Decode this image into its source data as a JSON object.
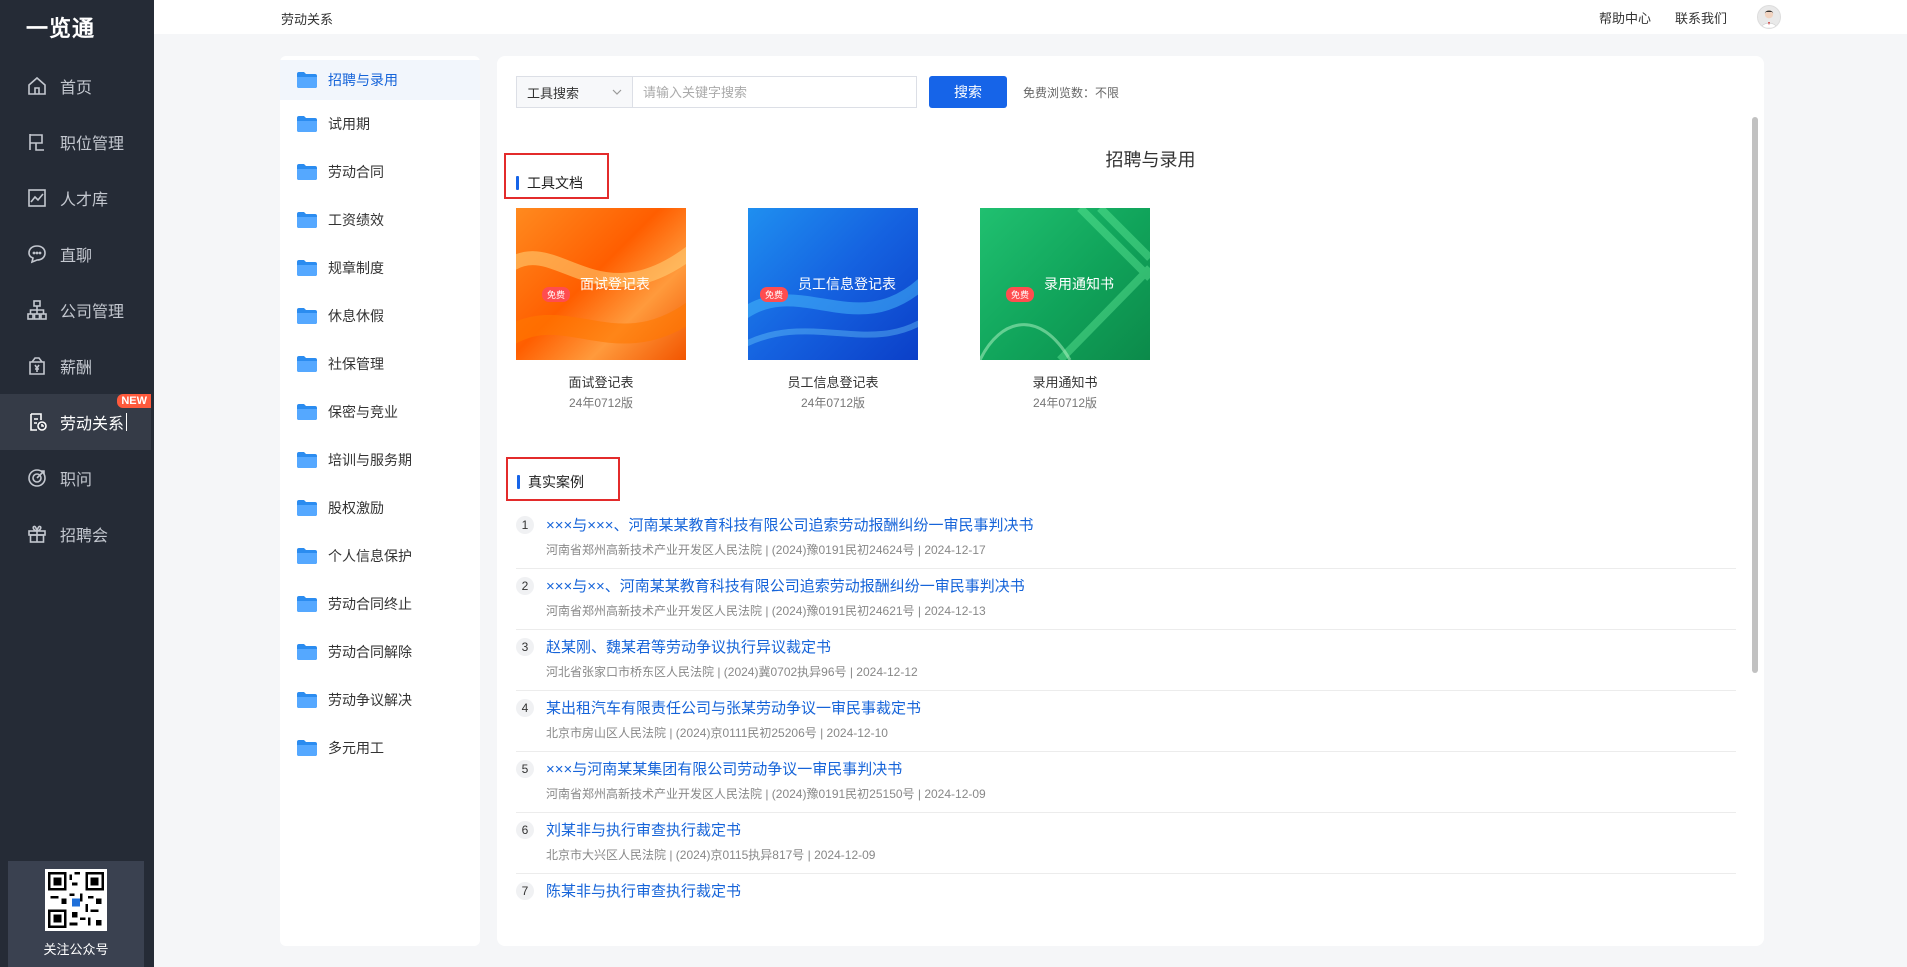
{
  "app": {
    "logo": "一览通"
  },
  "nav": {
    "items": [
      {
        "label": "首页",
        "icon": "home-icon"
      },
      {
        "label": "职位管理",
        "icon": "job-icon"
      },
      {
        "label": "人才库",
        "icon": "chart-icon"
      },
      {
        "label": "直聊",
        "icon": "chat-icon"
      },
      {
        "label": "公司管理",
        "icon": "org-icon"
      },
      {
        "label": "薪酬",
        "icon": "salary-icon"
      },
      {
        "label": "劳动关系",
        "icon": "contract-icon",
        "active": true,
        "badge": "NEW"
      },
      {
        "label": "职问",
        "icon": "target-icon"
      },
      {
        "label": "招聘会",
        "icon": "gift-icon"
      }
    ],
    "qr_label": "关注公众号"
  },
  "topbar": {
    "breadcrumb": "劳动关系",
    "help": "帮助中心",
    "contact": "联系我们"
  },
  "categories": [
    "招聘与录用",
    "试用期",
    "劳动合同",
    "工资绩效",
    "规章制度",
    "休息休假",
    "社保管理",
    "保密与竞业",
    "培训与服务期",
    "股权激励",
    "个人信息保护",
    "劳动合同终止",
    "劳动合同解除",
    "劳动争议解决",
    "多元用工"
  ],
  "search": {
    "type": "工具搜索",
    "placeholder": "请输入关键字搜索",
    "button": "搜索",
    "note": "免费浏览数：不限"
  },
  "page_heading": "招聘与录用",
  "tools": {
    "title": "工具文档",
    "free_tag": "免费",
    "cards": [
      {
        "thumb_text": "面试登记表",
        "name": "面试登记表",
        "version": "24年0712版",
        "color": "#ff6a00"
      },
      {
        "thumb_text": "员工信息登记表",
        "name": "员工信息登记表",
        "version": "24年0712版",
        "color": "#1a63e6"
      },
      {
        "thumb_text": "录用通知书",
        "name": "录用通知书",
        "version": "24年0712版",
        "color": "#14a85a"
      }
    ]
  },
  "cases": {
    "title": "真实案例",
    "items": [
      {
        "num": "1",
        "title": "×××与×××、河南某某教育科技有限公司追索劳动报酬纠纷一审民事判决书",
        "meta": "河南省郑州高新技术产业开发区人民法院 | (2024)豫0191民初24624号 | 2024-12-17"
      },
      {
        "num": "2",
        "title": "×××与××、河南某某教育科技有限公司追索劳动报酬纠纷一审民事判决书",
        "meta": "河南省郑州高新技术产业开发区人民法院 | (2024)豫0191民初24621号 | 2024-12-13"
      },
      {
        "num": "3",
        "title": "赵某刚、魏某君等劳动争议执行异议裁定书",
        "meta": "河北省张家口市桥东区人民法院 | (2024)冀0702执异96号 | 2024-12-12"
      },
      {
        "num": "4",
        "title": "某出租汽车有限责任公司与张某劳动争议一审民事裁定书",
        "meta": "北京市房山区人民法院 | (2024)京0111民初25206号 | 2024-12-10"
      },
      {
        "num": "5",
        "title": "×××与河南某某集团有限公司劳动争议一审民事判决书",
        "meta": "河南省郑州高新技术产业开发区人民法院 | (2024)豫0191民初25150号 | 2024-12-09"
      },
      {
        "num": "6",
        "title": "刘某非与执行审查执行裁定书",
        "meta": "北京市大兴区人民法院 | (2024)京0115执异817号 | 2024-12-09"
      },
      {
        "num": "7",
        "title": "陈某非与执行审查执行裁定书",
        "meta": ""
      }
    ]
  }
}
